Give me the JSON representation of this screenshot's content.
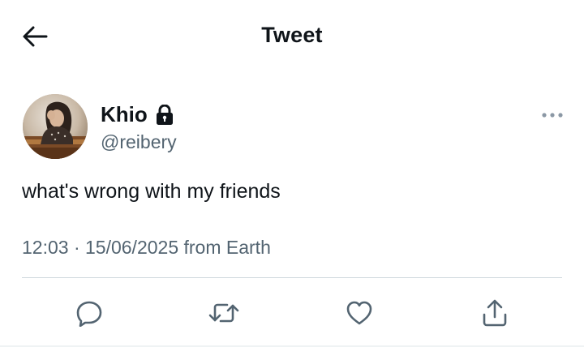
{
  "header": {
    "title": "Tweet",
    "back_icon": "arrow-left-icon"
  },
  "tweet": {
    "author": {
      "display_name": "Khio",
      "handle": "@reibery",
      "protected_icon": "lock-icon",
      "avatar": "profile-photo"
    },
    "text": "what's wrong with my friends",
    "meta": "12:03 · 15/06/2025 from Earth",
    "more_icon": "more-horizontal-icon",
    "actions": [
      "reply-icon",
      "retweet-icon",
      "like-icon",
      "share-icon"
    ]
  },
  "colors": {
    "text": "#0f1419",
    "secondary": "#536471",
    "divider": "#cfd9de",
    "background": "#ffffff"
  }
}
